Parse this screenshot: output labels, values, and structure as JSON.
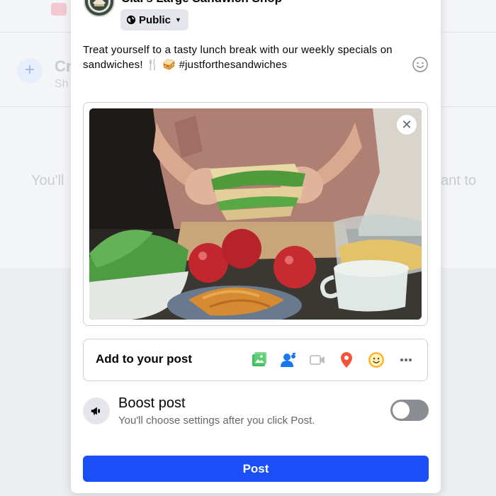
{
  "background": {
    "create_title_fragment": "Cr",
    "create_sub_fragment": "Sh",
    "left_text_fragment": "You'll",
    "right_text_fragment": "ant to"
  },
  "composer": {
    "page_name": "Cial's Large Sandwich Shop",
    "privacy_label": "Public",
    "post_text": "Treat yourself to a tasty lunch break with our weekly specials on sandwiches! 🍴 🥪 #justforthesandwiches",
    "add_to_post_label": "Add to your post",
    "add_icons": [
      "photo-video-icon",
      "tag-people-icon",
      "live-video-icon",
      "check-in-location-icon",
      "feeling-activity-icon",
      "more-icon"
    ],
    "boost": {
      "title": "Boost post",
      "subtitle": "You'll choose settings after you click Post.",
      "enabled": false
    },
    "post_button": "Post",
    "colors": {
      "primary": "#1b4ff7",
      "photo_icon": "#45bd62",
      "tag_icon": "#1877f2",
      "location_icon": "#f5533d",
      "feeling_icon": "#f7b928"
    }
  }
}
